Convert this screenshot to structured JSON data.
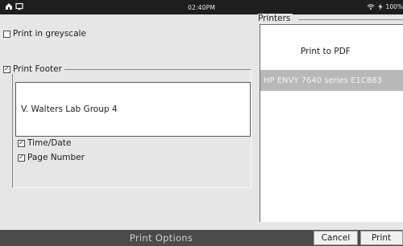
{
  "status_bar": {
    "time": "02:40PM",
    "battery": "100%",
    "icons": [
      "home-icon",
      "screen-icon",
      "wifi-icon",
      "battery-charging-icon"
    ]
  },
  "options": {
    "greyscale": {
      "label": "Print in greyscale",
      "checked": false
    },
    "footer": {
      "label": "Print Footer",
      "checked": true,
      "text_value": "V. Walters Lab Group 4",
      "time_date": {
        "label": "Time/Date",
        "checked": true
      },
      "page_number": {
        "label": "Page Number",
        "checked": true
      }
    }
  },
  "printers": {
    "legend": "Printers",
    "items": [
      {
        "label": "Print to PDF",
        "selected": false
      },
      {
        "label": "HP ENVY 7640 series E1C883",
        "selected": true
      }
    ]
  },
  "bottom_bar": {
    "title": "Print Options",
    "cancel_label": "Cancel",
    "print_label": "Print"
  },
  "colors": {
    "background": "#e6e6e6",
    "status_bar": "#1e1e1e",
    "bottom_bar": "#4b4b4b",
    "selected_printer": "#b8b8b8"
  }
}
